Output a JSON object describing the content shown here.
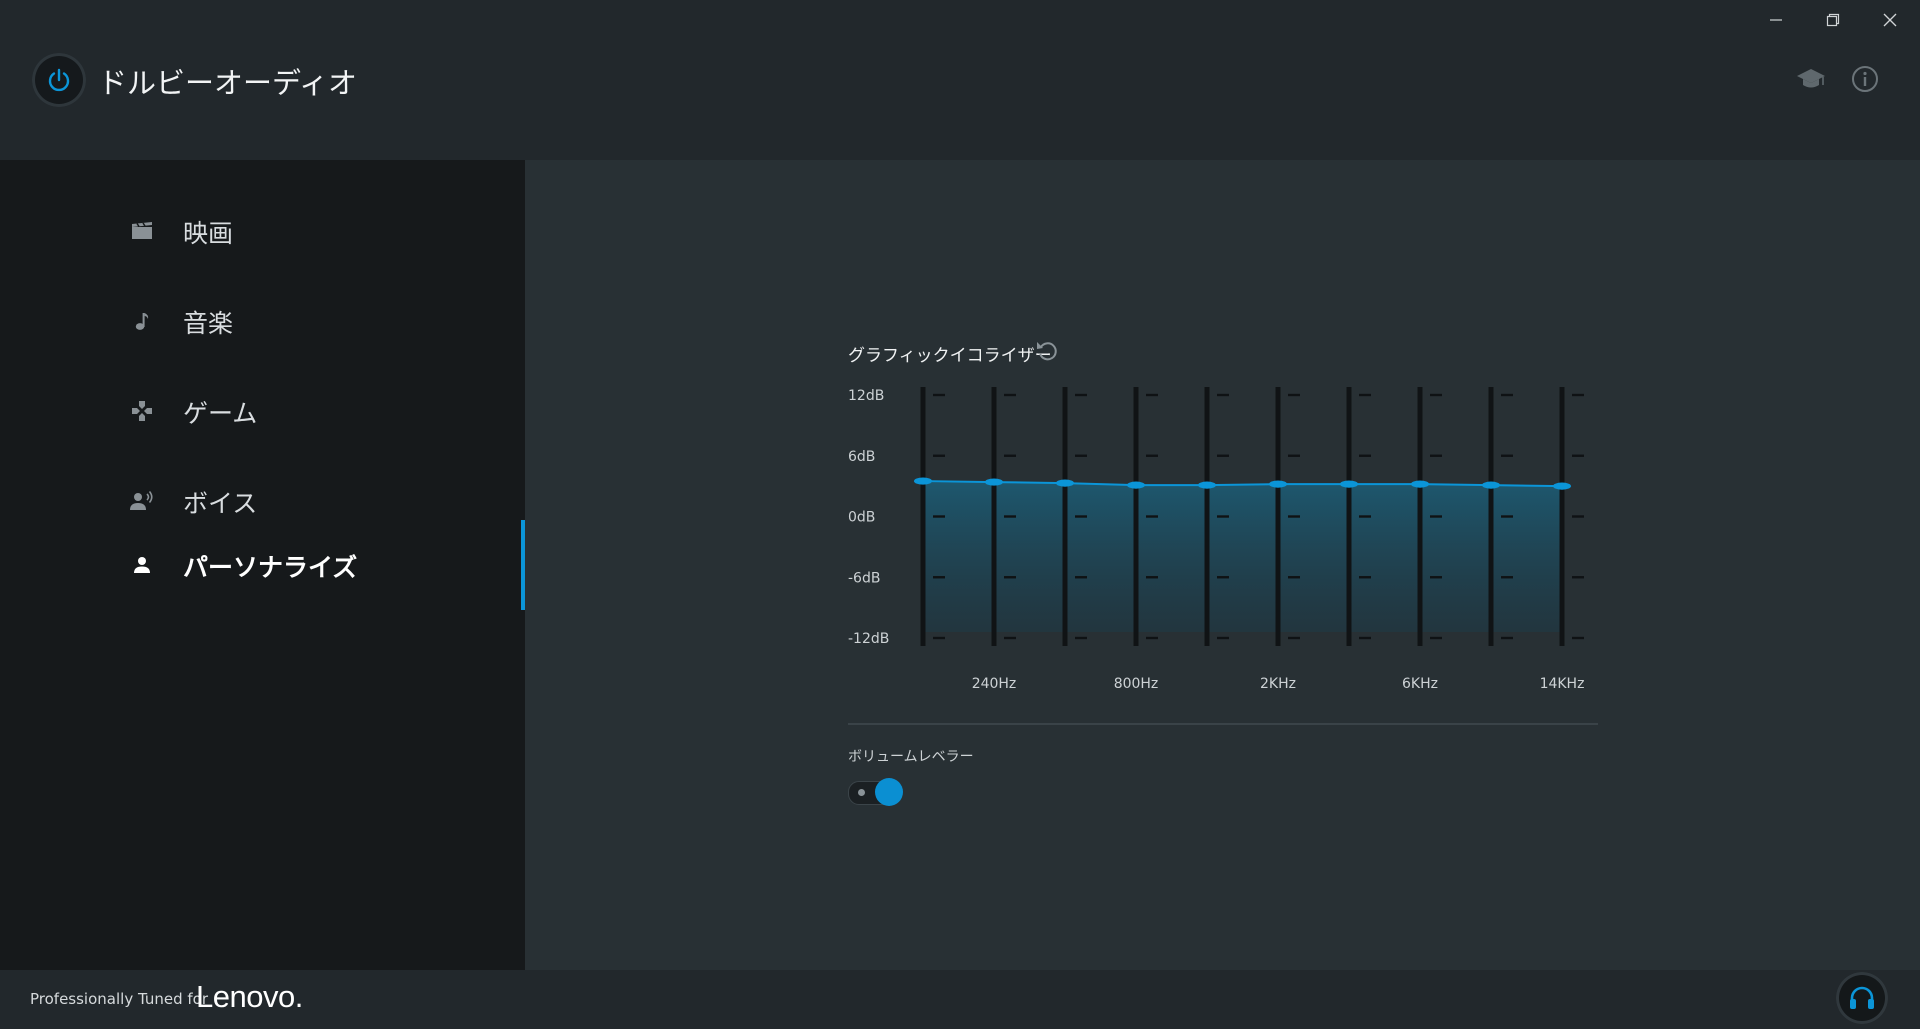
{
  "app": {
    "title": "ドルビーオーディオ"
  },
  "window_controls": {
    "minimize_icon": "minimize-icon",
    "maximize_icon": "restore-icon",
    "close_icon": "close-icon"
  },
  "header_icons": [
    "tutorial-cap-icon",
    "info-icon"
  ],
  "sidebar": {
    "items": [
      {
        "label": "映画",
        "icon": "film-icon",
        "active": false
      },
      {
        "label": "音楽",
        "icon": "music-note-icon",
        "active": false
      },
      {
        "label": "ゲーム",
        "icon": "gamepad-icon",
        "active": false
      },
      {
        "label": "ボイス",
        "icon": "voice-icon",
        "active": false
      },
      {
        "label": "パーソナライズ",
        "icon": "person-icon",
        "active": true
      }
    ]
  },
  "equalizer": {
    "title": "グラフィックイコライザー",
    "reset_icon": "reset-icon",
    "y_labels": [
      "12dB",
      "6dB",
      "0dB",
      "-6dB",
      "-12dB"
    ],
    "x_labels": [
      "240Hz",
      "800Hz",
      "2KHz",
      "6KHz",
      "14KHz"
    ],
    "colors": {
      "accent": "#0b95d8",
      "fill": "#1f4a5c"
    }
  },
  "chart_data": {
    "type": "line",
    "bands": 10,
    "ylim": [
      -12,
      12
    ],
    "unit": "dB",
    "y_ticks": [
      12,
      6,
      0,
      -6,
      -12
    ],
    "x_tick_labels": [
      "240Hz",
      "800Hz",
      "2KHz",
      "6KHz",
      "14KHz"
    ],
    "x_tick_band_index": [
      1,
      3,
      5,
      7,
      9
    ],
    "values": [
      3.5,
      3.4,
      3.3,
      3.1,
      3.1,
      3.2,
      3.2,
      3.2,
      3.1,
      3.0
    ]
  },
  "volume_leveler": {
    "label": "ボリュームレベラー",
    "enabled": true
  },
  "footer": {
    "text": "Professionally Tuned for",
    "brand": "Lenovo."
  },
  "output_device_icon": "headphones-icon"
}
